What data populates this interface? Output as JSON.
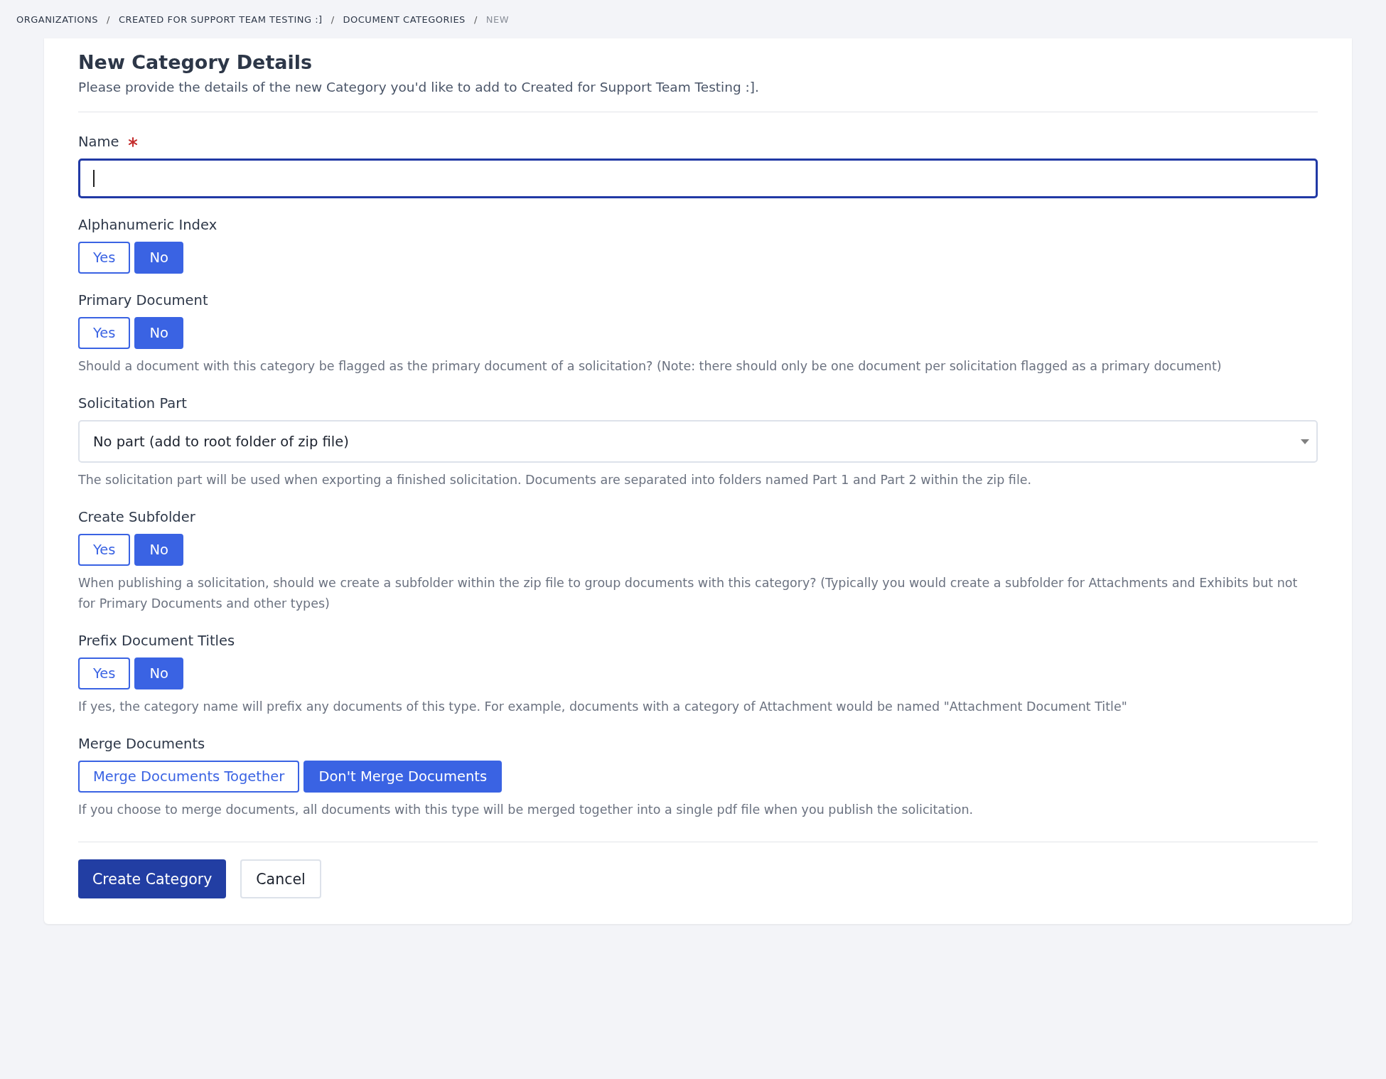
{
  "breadcrumb": [
    {
      "label": "ORGANIZATIONS",
      "current": false
    },
    {
      "label": "CREATED FOR SUPPORT TEAM TESTING :]",
      "current": false
    },
    {
      "label": "DOCUMENT CATEGORIES",
      "current": false
    },
    {
      "label": "NEW",
      "current": true
    }
  ],
  "separator": "/",
  "form": {
    "title": "New Category Details",
    "subtitle": "Please provide the details of the new Category you'd like to add to Created for Support Team Testing :].",
    "fields": [
      {
        "kind": "text",
        "label": "Name",
        "required": true,
        "focused": true
      },
      {
        "kind": "toggle",
        "label": "Alphanumeric Index",
        "options": [
          {
            "label": "Yes",
            "selected": false
          },
          {
            "label": "No",
            "selected": true
          }
        ]
      },
      {
        "kind": "toggle",
        "label": "Primary Document",
        "options": [
          {
            "label": "Yes",
            "selected": false
          },
          {
            "label": "No",
            "selected": true
          }
        ],
        "help": "Should a document with this category be flagged as the primary document of a solicitation? (Note: there should only be one document per solicitation flagged as a primary document)"
      },
      {
        "kind": "select",
        "label": "Solicitation Part",
        "value": "No part (add to root folder of zip file)",
        "help": "The solicitation part will be used when exporting a finished solicitation. Documents are separated into folders named Part 1 and Part 2 within the zip file."
      },
      {
        "kind": "toggle",
        "label": "Create Subfolder",
        "options": [
          {
            "label": "Yes",
            "selected": false
          },
          {
            "label": "No",
            "selected": true
          }
        ],
        "help": "When publishing a solicitation, should we create a subfolder within the zip file to group documents with this category? (Typically you would create a subfolder for Attachments and Exhibits but not for Primary Documents and other types)"
      },
      {
        "kind": "toggle",
        "label": "Prefix Document Titles",
        "options": [
          {
            "label": "Yes",
            "selected": false
          },
          {
            "label": "No",
            "selected": true
          }
        ],
        "help": "If yes, the category name will prefix any documents of this type. For example, documents with a category of Attachment would be named \"Attachment Document Title\""
      },
      {
        "kind": "toggle",
        "label": "Merge Documents",
        "options": [
          {
            "label": "Merge Documents Together",
            "selected": false
          },
          {
            "label": "Don't Merge Documents",
            "selected": true
          }
        ],
        "help": "If you choose to merge documents, all documents with this type will be merged together into a single pdf file when you publish the solicitation."
      }
    ],
    "actions": [
      {
        "label": "Create Category",
        "kind": "primary"
      },
      {
        "label": "Cancel",
        "kind": "secondary"
      }
    ]
  }
}
